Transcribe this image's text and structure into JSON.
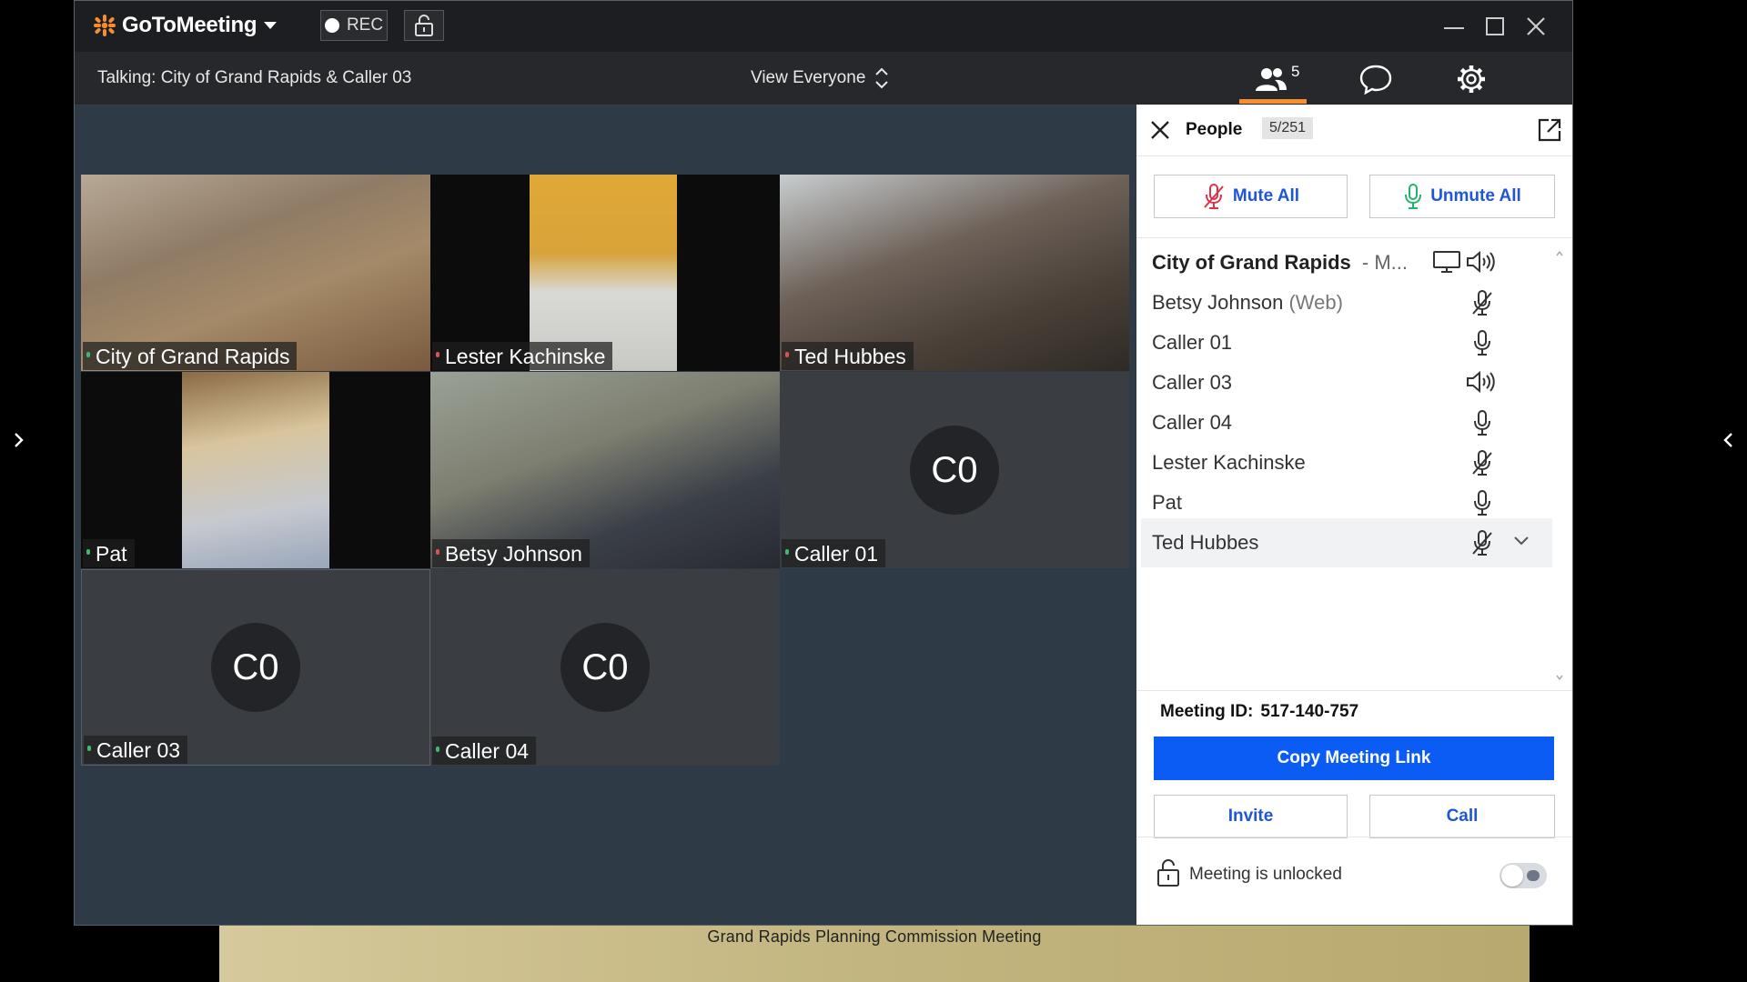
{
  "app": {
    "name": "GoToMeeting",
    "rec_label": "REC"
  },
  "toolbar": {
    "talking": "Talking: City of Grand Rapids & Caller 03",
    "view_label": "View Everyone",
    "people_count": "5"
  },
  "tiles": [
    {
      "name": "City of Grand Rapids",
      "avatar": ""
    },
    {
      "name": "Lester Kachinske",
      "avatar": ""
    },
    {
      "name": "Ted Hubbes",
      "avatar": ""
    },
    {
      "name": "Pat",
      "avatar": ""
    },
    {
      "name": "Betsy Johnson",
      "avatar": ""
    },
    {
      "name": "Caller 01",
      "avatar": "C0"
    },
    {
      "name": "Caller 03",
      "avatar": "C0"
    },
    {
      "name": "Caller 04",
      "avatar": "C0"
    }
  ],
  "people": {
    "title": "People",
    "count": "5/251",
    "mute_all": "Mute All",
    "unmute_all": "Unmute All",
    "organizer": {
      "name": "City of Grand Rapids",
      "suffix": "- M..."
    },
    "list": [
      {
        "name": "Betsy Johnson",
        "sub": "(Web)",
        "status": "mic-muted-icon"
      },
      {
        "name": "Caller 01",
        "sub": "",
        "status": "mic-icon"
      },
      {
        "name": "Caller 03",
        "sub": "",
        "status": "speaker-icon"
      },
      {
        "name": "Caller 04",
        "sub": "",
        "status": "mic-icon"
      },
      {
        "name": "Lester Kachinske",
        "sub": "",
        "status": "mic-muted-icon"
      },
      {
        "name": "Pat",
        "sub": "",
        "status": "mic-icon"
      },
      {
        "name": "Ted Hubbes",
        "sub": "",
        "status": "mic-muted-icon"
      }
    ],
    "meeting_id_label": "Meeting ID:",
    "meeting_id": "517-140-757",
    "copy_link": "Copy Meeting Link",
    "invite": "Invite",
    "call": "Call",
    "lock_status": "Meeting is unlocked"
  },
  "banner": {
    "text": "Grand Rapids Planning Commission Meeting"
  },
  "colors": {
    "accent_orange": "#f68d2e",
    "primary_blue": "#0b5cf5",
    "mute_red": "#e0314b",
    "unmute_green": "#21b36b"
  }
}
